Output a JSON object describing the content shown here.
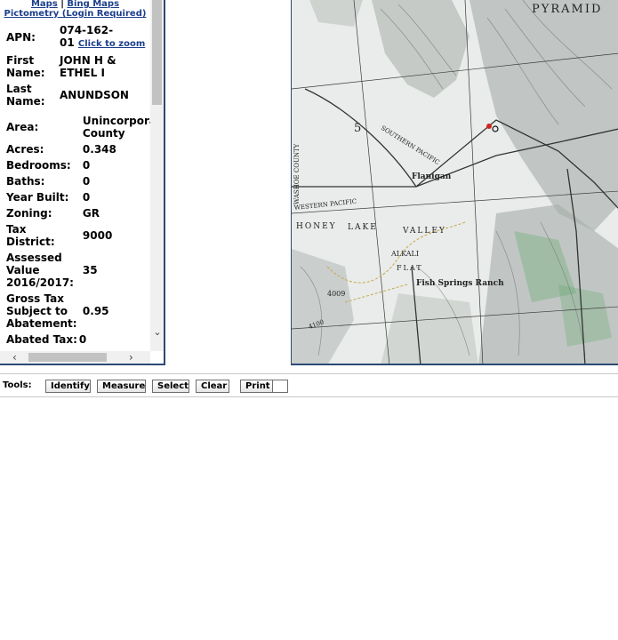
{
  "links": {
    "maps": "Maps",
    "separator": "|",
    "bing_maps": "Bing Maps",
    "pictometry": "Pictometry (Login Required)"
  },
  "parcel": {
    "apn_label": "APN:",
    "apn_line1": "074-162-",
    "apn_line2": "01",
    "zoom_link": "Click to zoom",
    "first_name_label_1": "First",
    "first_name_label_2": "Name:",
    "first_name_1": "JOHN H &",
    "first_name_2": "ETHEL I",
    "last_name_label_1": "Last",
    "last_name_label_2": "Name:",
    "last_name": "ANUNDSON",
    "area_label": "Area:",
    "area_1": "Unincorpora",
    "area_2": "County",
    "acres_label": "Acres:",
    "acres": "0.348",
    "bedrooms_label": "Bedrooms:",
    "bedrooms": "0",
    "baths_label": "Baths:",
    "baths": "0",
    "year_built_label": "Year Built:",
    "year_built": "0",
    "zoning_label": "Zoning:",
    "zoning": "GR",
    "tax_district_label_1": "Tax",
    "tax_district_label_2": "District:",
    "tax_district": "9000",
    "assessed_label_1": "Assessed",
    "assessed_label_2": "Value",
    "assessed_label_3": "2016/2017:",
    "assessed_value": "35",
    "gross_tax_label_1": "Gross Tax",
    "gross_tax_label_2": "Subject to",
    "gross_tax_label_3": "Abatement:",
    "gross_tax": "0.95",
    "abated_tax_label": "Abated Tax:",
    "abated_tax": "0"
  },
  "scrollbar": {
    "down_arrow": "⌄",
    "left_arrow": "‹",
    "right_arrow": "›"
  },
  "map": {
    "labels": {
      "pyramid": "PYRAMID",
      "section": "5",
      "southern_pacific": "SOUTHERN PACIFIC",
      "flanigan": "Flanigan",
      "western_pacific": "WESTERN PACIFIC",
      "honey": "HONEY",
      "lake": "LAKE",
      "valley": "VALLEY",
      "alkali": "ALKALI",
      "flat": "FLAT",
      "fish_springs_ranch": "Fish Springs Ranch",
      "washoe_county": "WASHOE COUNTY",
      "elev_4009": "4009",
      "elev_4100": "4100"
    },
    "colors": {
      "background": "#e9ecea",
      "relief": "#9aa29f",
      "road": "#333333",
      "trail": "#c8a64a",
      "vegetation": "#4a9a55"
    }
  },
  "toolbar": {
    "tools_label": "Tools:",
    "identify": "Identify",
    "measure": "Measure",
    "select": "Select",
    "clear": "Clear",
    "print": "Print"
  }
}
